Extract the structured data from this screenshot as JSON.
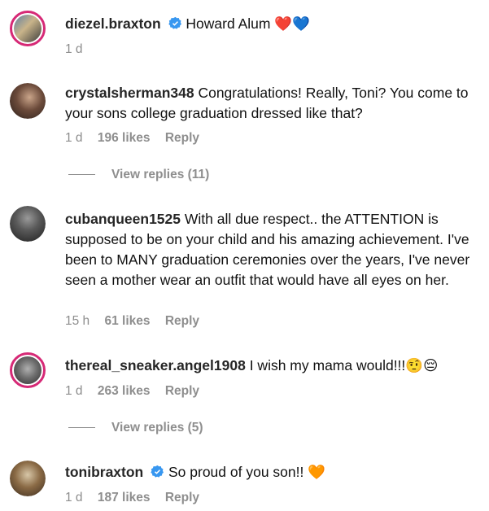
{
  "comments": [
    {
      "username": "diezel.braxton",
      "verified": true,
      "text": "Howard Alum",
      "emoji": "❤️💙",
      "time": "1 d"
    },
    {
      "username": "crystalsherman348",
      "text": "Congratulations! Really, Toni? You come to your sons college graduation dressed like that?",
      "time": "1 d",
      "likes": "196 likes",
      "reply": "Reply",
      "view_replies": "View replies (11)"
    },
    {
      "username": "cubanqueen1525",
      "text": "With all due respect.. the ATTENTION is supposed to be on your child and his amazing achievement. I've been to MANY graduation ceremonies over the years, I've never seen a mother wear an outfit that would have all eyes on her.",
      "time": "15 h",
      "likes": "61 likes",
      "reply": "Reply"
    },
    {
      "username": "thereal_sneaker.angel1908",
      "text": "I wish my mama would!!!",
      "emoji": "🤨😔",
      "time": "1 d",
      "likes": "263 likes",
      "reply": "Reply",
      "view_replies": "View replies (5)"
    },
    {
      "username": "tonibraxton",
      "verified": true,
      "text": "So proud of you son!!",
      "emoji": "🧡",
      "time": "1 d",
      "likes": "187 likes",
      "reply": "Reply"
    }
  ],
  "colors": {
    "story_ring": "#d62976",
    "verified": "#3897f0",
    "meta_gray": "#8e8e8e"
  }
}
